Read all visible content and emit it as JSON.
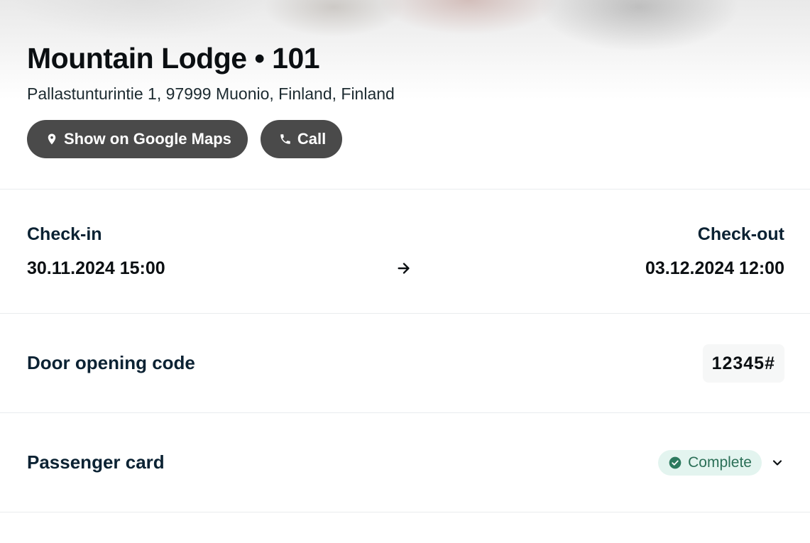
{
  "property": {
    "title": "Mountain Lodge • 101",
    "address": "Pallastunturintie 1, 97999 Muonio, Finland, Finland"
  },
  "actions": {
    "maps_label": "Show on Google Maps",
    "call_label": "Call"
  },
  "stay": {
    "checkin_label": "Check-in",
    "checkin_value": "30.11.2024 15:00",
    "checkout_label": "Check-out",
    "checkout_value": "03.12.2024 12:00"
  },
  "door": {
    "label": "Door opening code",
    "code": "12345#"
  },
  "passenger": {
    "label": "Passenger card",
    "status": "Complete"
  },
  "colors": {
    "button_bg": "#4a4a4a",
    "badge_bg": "#e3f4ef",
    "badge_text": "#2b6f57",
    "check_icon": "#2d7a5f"
  },
  "icons": [
    "map-pin-icon",
    "phone-icon",
    "arrow-right-icon",
    "check-circle-icon",
    "chevron-down-icon"
  ]
}
